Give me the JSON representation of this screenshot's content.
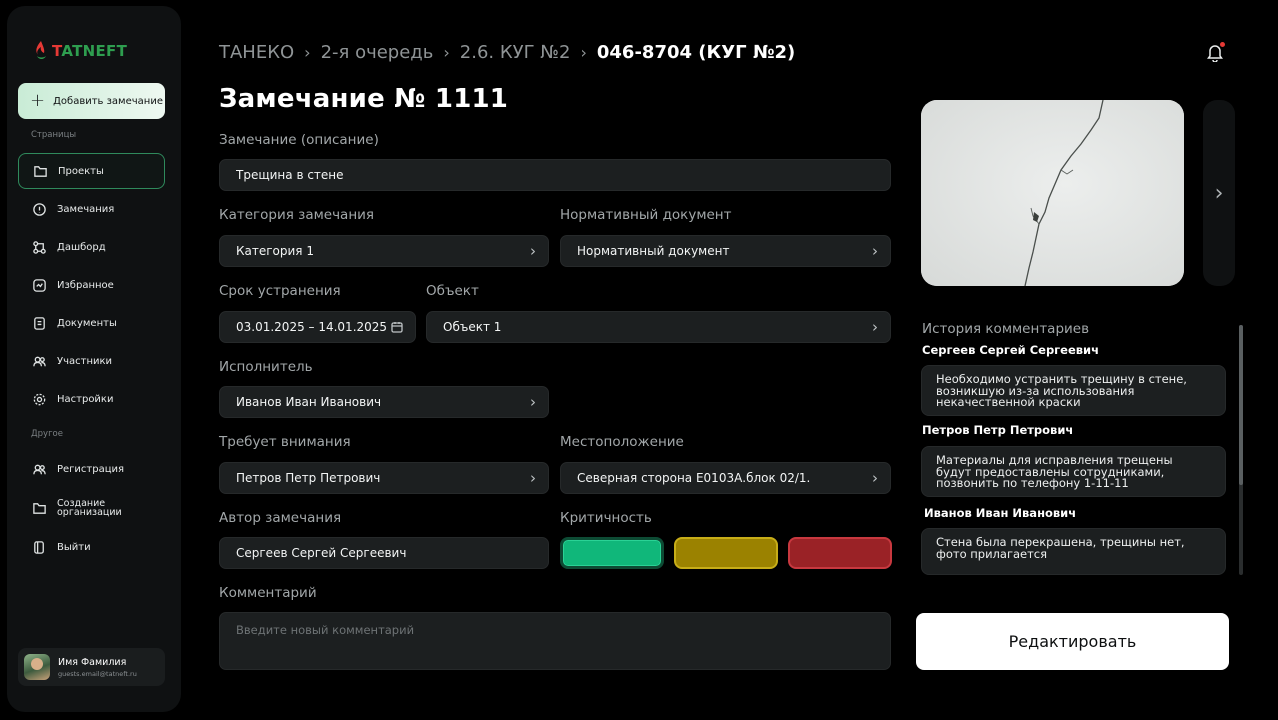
{
  "brand": {
    "logo_text_t": "T",
    "logo_text_rest": "ATNEFT"
  },
  "sidebar": {
    "add_button": "Добавить замечание",
    "section_pages": "Страницы",
    "section_other": "Другое",
    "items": [
      {
        "label": "Проекты",
        "icon": "folder-icon"
      },
      {
        "label": "Замечания",
        "icon": "alert-circle-icon"
      },
      {
        "label": "Дашборд",
        "icon": "dashboard-icon"
      },
      {
        "label": "Избранное",
        "icon": "favorites-icon"
      },
      {
        "label": "Документы",
        "icon": "document-icon"
      },
      {
        "label": "Участники",
        "icon": "users-icon"
      },
      {
        "label": "Настройки",
        "icon": "gear-icon"
      }
    ],
    "other_items": [
      {
        "label": "Регистрация",
        "icon": "users-icon"
      },
      {
        "label_line1": "Создание",
        "label_line2": "организации",
        "icon": "folder-icon"
      },
      {
        "label": "Выйти",
        "icon": "logout-icon"
      }
    ],
    "user": {
      "name": "Имя Фамилия",
      "email": "guests.email@tatneft.ru"
    }
  },
  "breadcrumb": {
    "items": [
      "ТАНЕКО",
      "2-я очередь",
      "2.6. КУГ №2"
    ],
    "current": "046-8704 (КУГ №2)"
  },
  "page_title": "Замечание № 1111",
  "form": {
    "description_label": "Замечание (описание)",
    "description_value": "Трещина в стене",
    "category_label": "Категория замечания",
    "category_value": "Категория 1",
    "normative_label": "Нормативный документ",
    "normative_value": "Нормативный документ",
    "deadline_label": "Срок устранения",
    "deadline_value": "03.01.2025 – 14.01.2025",
    "object_label": "Объект",
    "object_value": "Объект 1",
    "executor_label": "Исполнитель",
    "executor_value": "Иванов Иван Иванович",
    "attention_label": "Требует внимания",
    "attention_value": "Петров Петр Петрович",
    "location_label": "Местоположение",
    "location_value": "Северная сторона Е0103А.блок 02/1.",
    "author_label": "Автор замечания",
    "author_value": "Сергеев Сергей Сергеевич",
    "criticality_label": "Критичность",
    "criticality_colors": {
      "low": "#10b77a",
      "medium": "#9b8200",
      "high": "#9a2226"
    },
    "comment_label": "Комментарий",
    "comment_placeholder": "Введите новый комментарий"
  },
  "history": {
    "title": "История комментариев",
    "comments": [
      {
        "author": "Сергеев Сергей Сергеевич",
        "lines": [
          "Необходимо устранить трещину в стене,",
          "возникшую из-за использования",
          "некачественной краски"
        ]
      },
      {
        "author": "Петров Петр Петрович",
        "lines": [
          "Материалы для исправления трещены",
          "будут предоставлены сотрудниками,",
          "позвонить по телефону 1-11-11"
        ]
      },
      {
        "author": "Иванов Иван Иванович",
        "lines": [
          "Стена была перекрашена, трещины нет,",
          "фото прилагается"
        ]
      }
    ]
  },
  "edit_button": "Редактировать"
}
